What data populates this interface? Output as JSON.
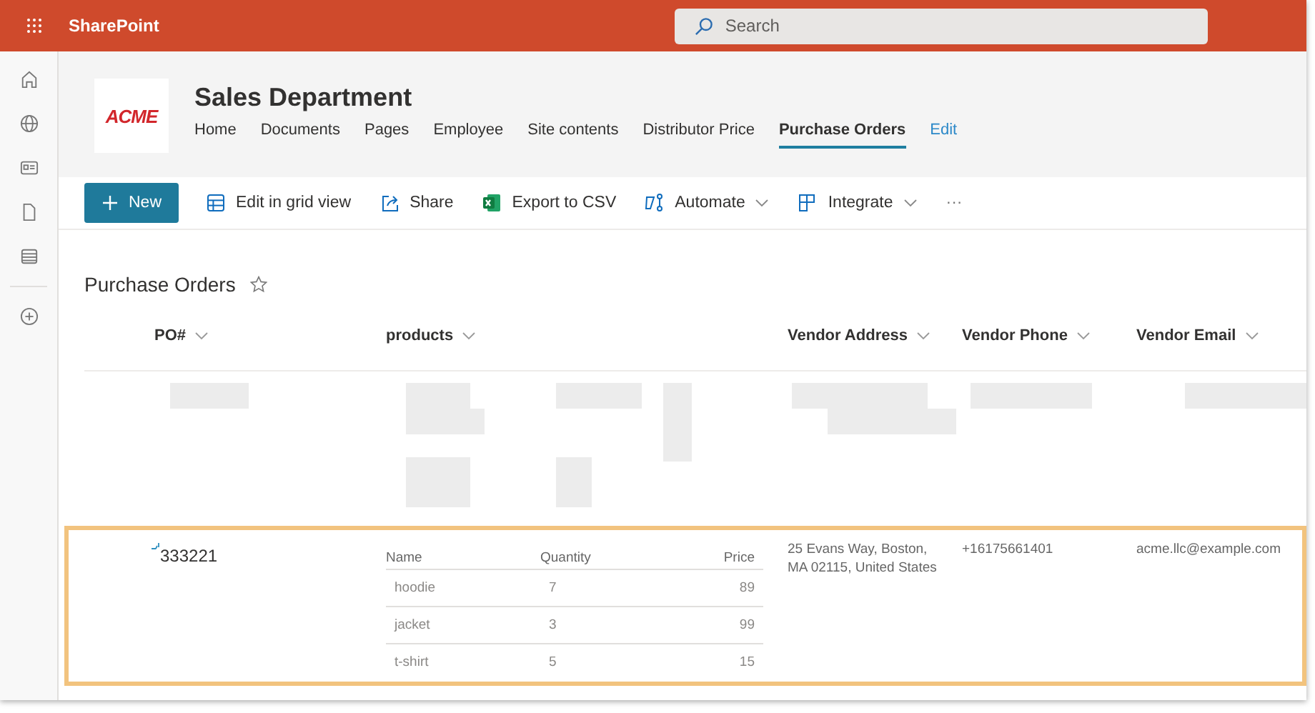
{
  "app_bar": {
    "app_name": "SharePoint",
    "search": {
      "placeholder": "Search"
    }
  },
  "site": {
    "logo_text": "ACME",
    "title": "Sales Department",
    "nav": [
      {
        "label": "Home",
        "selected": false,
        "kind": "page"
      },
      {
        "label": "Documents",
        "selected": false,
        "kind": "page"
      },
      {
        "label": "Pages",
        "selected": false,
        "kind": "page"
      },
      {
        "label": "Employee",
        "selected": false,
        "kind": "page"
      },
      {
        "label": "Site contents",
        "selected": false,
        "kind": "page"
      },
      {
        "label": "Distributor Price",
        "selected": false,
        "kind": "page"
      },
      {
        "label": "Purchase Orders",
        "selected": true,
        "kind": "page"
      },
      {
        "label": "Edit",
        "selected": false,
        "kind": "edit"
      }
    ]
  },
  "commands": [
    {
      "kind": "new",
      "label": "New",
      "dropdown": false
    },
    {
      "kind": "grid",
      "label": "Edit in grid view",
      "dropdown": false
    },
    {
      "kind": "share",
      "label": "Share",
      "dropdown": false
    },
    {
      "kind": "excel",
      "label": "Export to CSV",
      "dropdown": false
    },
    {
      "kind": "automate",
      "label": "Automate",
      "dropdown": true
    },
    {
      "kind": "integrate",
      "label": "Integrate",
      "dropdown": true
    },
    {
      "kind": "more",
      "label": "···",
      "dropdown": false
    }
  ],
  "list": {
    "title": "Purchase Orders",
    "favorite": false,
    "columns": [
      "PO#",
      "products",
      "Vendor Address",
      "Vendor Phone",
      "Vendor Email"
    ],
    "rows": [
      {
        "redacted": true,
        "highlighted": false
      },
      {
        "redacted": false,
        "highlighted": true,
        "po": "333221",
        "products": {
          "columns": [
            "Name",
            "Quantity",
            "Price"
          ],
          "rows": [
            [
              "hoodie",
              "7",
              "89"
            ],
            [
              "jacket",
              "3",
              "99"
            ],
            [
              "t-shirt",
              "5",
              "15"
            ]
          ]
        },
        "vendor_address": "25 Evans Way, Boston, MA 02115, United States",
        "vendor_phone": "+16175661401",
        "vendor_email": "acme.llc@example.com"
      }
    ]
  }
}
